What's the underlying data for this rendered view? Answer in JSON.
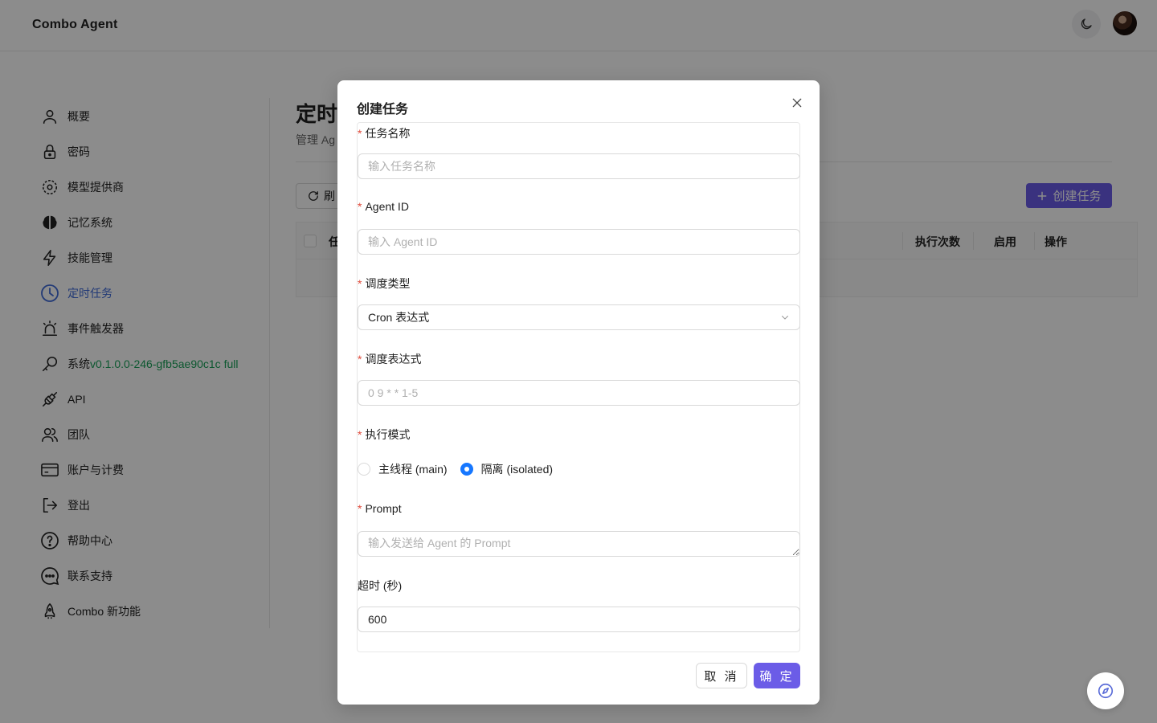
{
  "app": {
    "title": "Combo Agent"
  },
  "header": {
    "theme_icon": "moon-icon",
    "avatar": "user-avatar"
  },
  "sidebar": {
    "items": [
      {
        "label": "概要",
        "icon": "user-icon"
      },
      {
        "label": "密码",
        "icon": "lock-icon"
      },
      {
        "label": "模型提供商",
        "icon": "model-provider-icon"
      },
      {
        "label": "记忆系统",
        "icon": "brain-icon"
      },
      {
        "label": "技能管理",
        "icon": "lightning-icon"
      },
      {
        "label": "定时任务",
        "icon": "clock-icon",
        "active": true
      },
      {
        "label": "事件触发器",
        "icon": "alarm-icon"
      },
      {
        "label": "系统",
        "icon": "key-icon",
        "version": "v0.1.0.0-246-gfb5ae90c1c full"
      },
      {
        "label": "API",
        "icon": "plug-icon"
      },
      {
        "label": "团队",
        "icon": "team-icon"
      },
      {
        "label": "账户与计费",
        "icon": "card-icon"
      },
      {
        "label": "登出",
        "icon": "logout-icon"
      },
      {
        "label": "帮助中心",
        "icon": "help-icon"
      },
      {
        "label": "联系支持",
        "icon": "chat-icon"
      },
      {
        "label": "Combo 新功能",
        "icon": "rocket-icon"
      }
    ]
  },
  "main": {
    "title": "定时",
    "subtitle": "管理 Ag",
    "refresh_label": "刷",
    "create_label": "创建任务",
    "table_headers": {
      "first": "任",
      "runs": "执行次数",
      "enabled": "启用",
      "actions": "操作"
    }
  },
  "modal": {
    "title": "创建任务",
    "fields": {
      "name": {
        "label": "任务名称",
        "placeholder": "输入任务名称"
      },
      "agent": {
        "label": "Agent ID",
        "placeholder": "输入 Agent ID"
      },
      "schedule_type": {
        "label": "调度类型",
        "value": "Cron 表达式"
      },
      "expression": {
        "label": "调度表达式",
        "placeholder": "0 9 * * 1-5"
      },
      "mode": {
        "label": "执行模式",
        "options": [
          "主线程 (main)",
          "隔离 (isolated)"
        ],
        "selected": "隔离 (isolated)"
      },
      "prompt": {
        "label": "Prompt",
        "placeholder": "输入发送给 Agent 的 Prompt"
      },
      "timeout": {
        "label": "超时 (秒)",
        "value": "600"
      }
    },
    "cancel_label": "取 消",
    "ok_label": "确 定"
  },
  "colors": {
    "accent": "#6b5ce7",
    "active_nav": "#3f6ad8",
    "version": "#18a058",
    "required": "#e04a3a",
    "radio": "#1677ff"
  }
}
